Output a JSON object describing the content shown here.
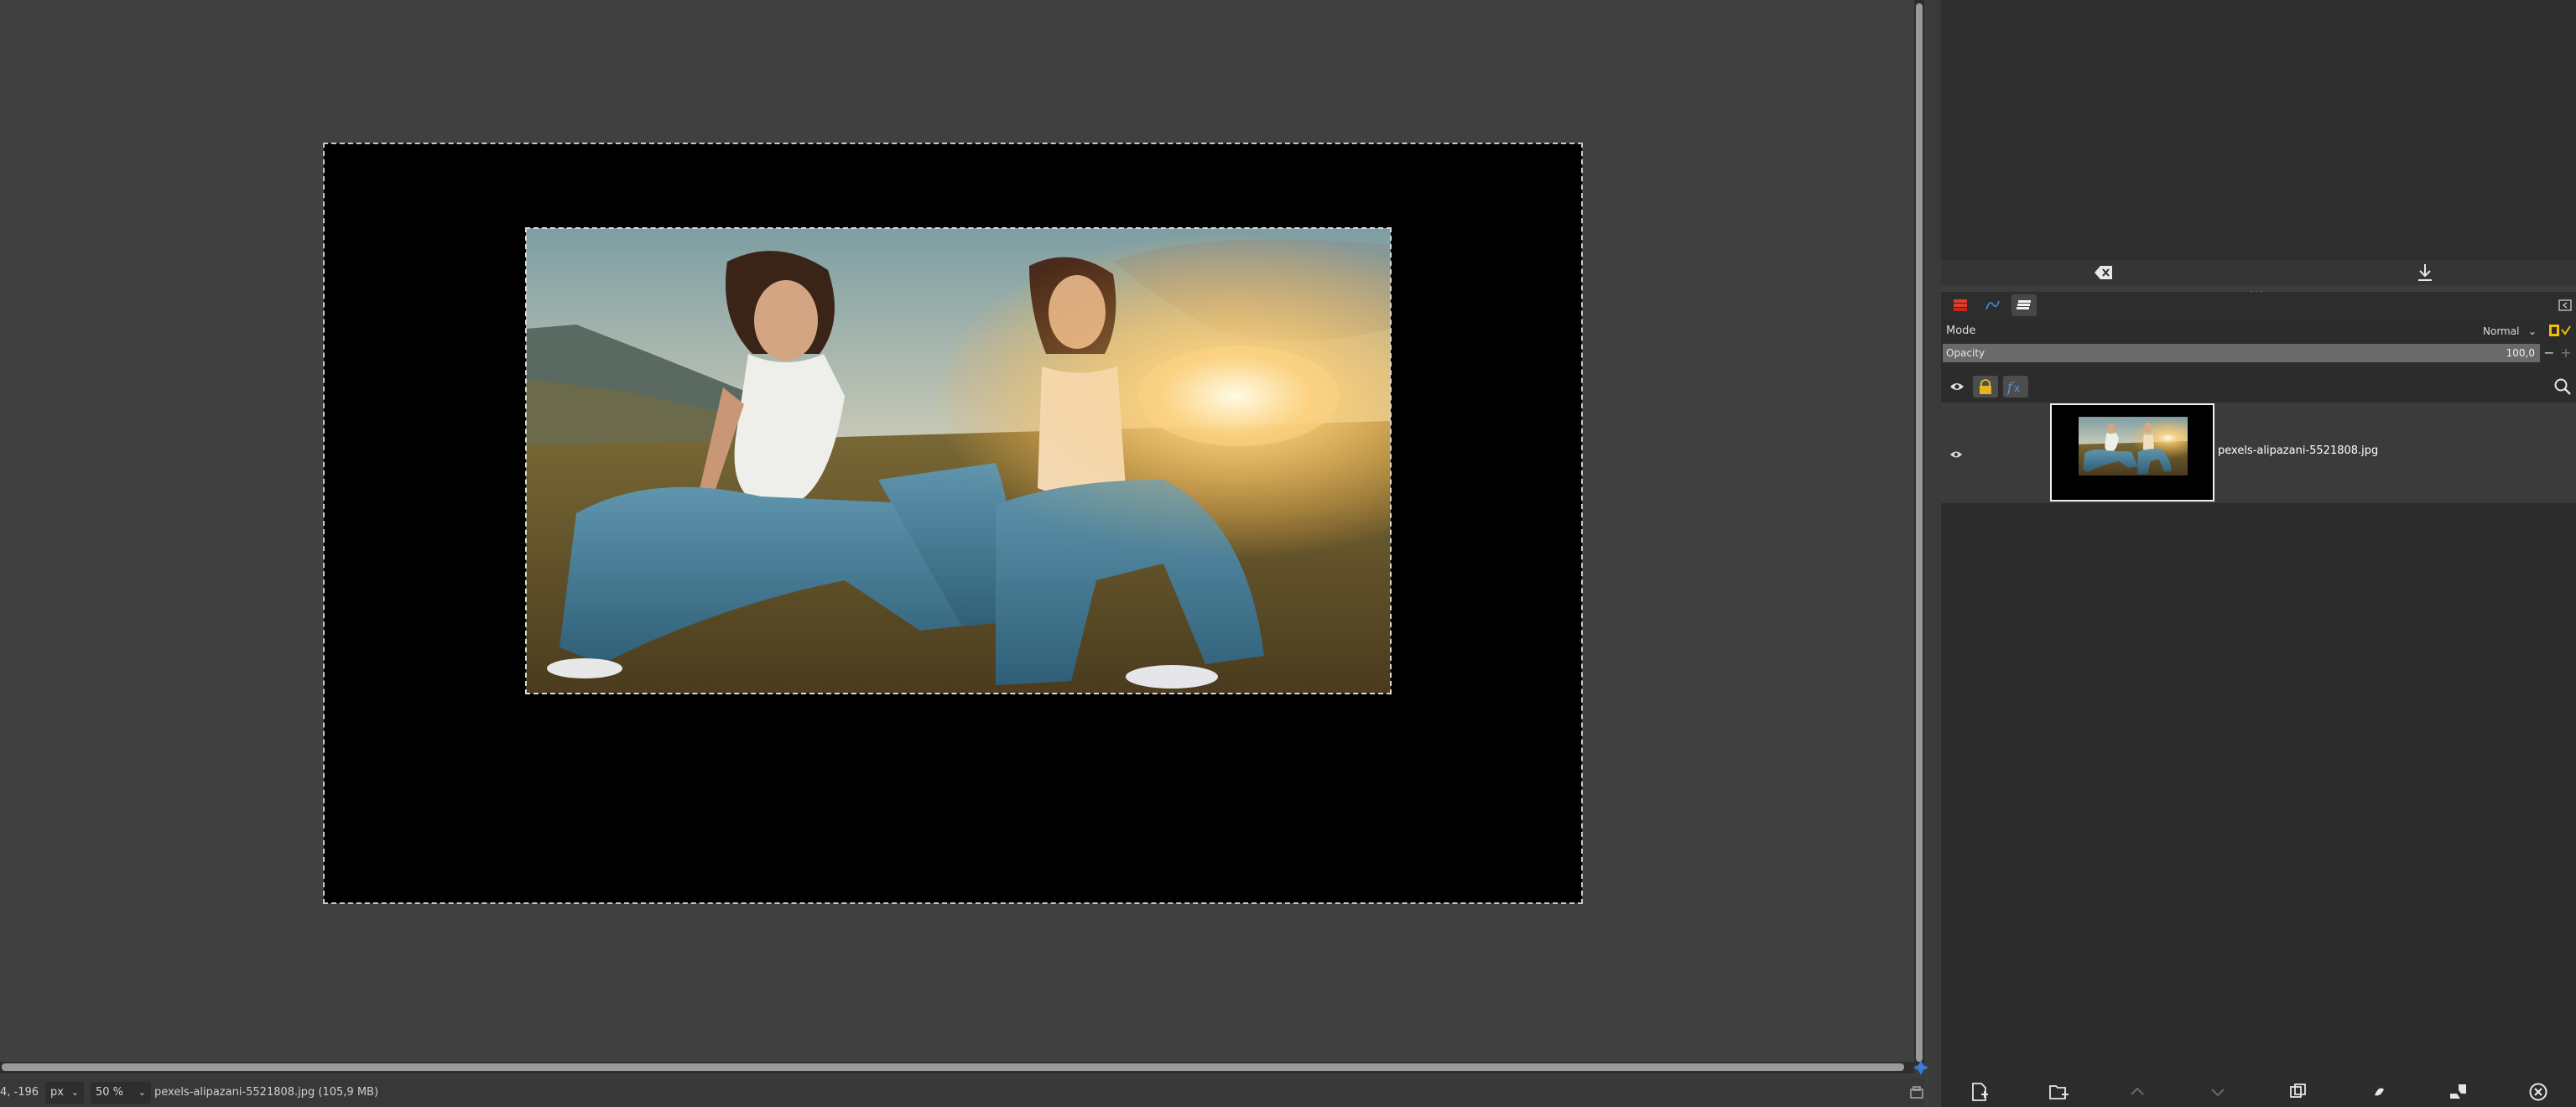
{
  "canvas": {
    "image_name": "pexels-alipazani-5521808.jpg"
  },
  "statusbar": {
    "coordinates": "4, -196",
    "unit": "px",
    "zoom": "50 %",
    "file_info": "pexels-alipazani-5521808.jpg (105,9 MB)"
  },
  "layers": {
    "mode_label": "Mode",
    "mode_value": "Normal",
    "opacity_label": "Opacity",
    "opacity_value": "100,0",
    "items": [
      {
        "name": "pexels-alipazani-5521808.jpg",
        "visible": true
      }
    ]
  },
  "icons": {
    "dock_clear": "backspace-icon",
    "dock_export": "download-icon",
    "tab_layers": "layers-tab-icon",
    "tab_channels": "channels-tab-icon",
    "tab_paths": "paths-tab-icon",
    "eye": "eye-icon",
    "lock": "lock-icon",
    "fx": "fx-icon",
    "search": "search-icon"
  },
  "colors": {
    "canvas_bg": "#404040",
    "dock_bg": "#2c2c2c",
    "accent_yellow": "#f0c000"
  }
}
